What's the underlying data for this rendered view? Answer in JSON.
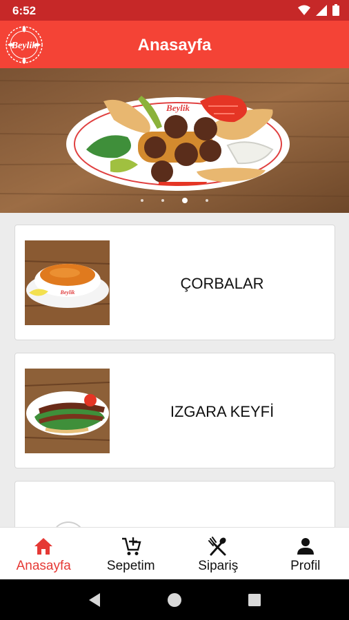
{
  "status_bar": {
    "time": "6:52",
    "icons": [
      "wifi-icon",
      "signal-icon",
      "battery-icon"
    ]
  },
  "app_bar": {
    "title": "Anasayfa",
    "logo_text": "Beylik"
  },
  "banner": {
    "plate_text": "Beylik",
    "slide_count": 4,
    "active_slide": 3
  },
  "categories": [
    {
      "label": "ÇORBALAR",
      "image": "soup-bowl"
    },
    {
      "label": "IZGARA KEYFİ",
      "image": "grilled-kebab-plate"
    },
    {
      "label": "",
      "image": "loading"
    }
  ],
  "bottom_nav": [
    {
      "label": "Anasayfa",
      "icon": "home-icon",
      "active": true
    },
    {
      "label": "Sepetim",
      "icon": "cart-add-icon",
      "active": false
    },
    {
      "label": "Sipariş",
      "icon": "utensils-icon",
      "active": false
    },
    {
      "label": "Profil",
      "icon": "person-icon",
      "active": false
    }
  ],
  "system_nav": [
    "back-icon",
    "home-circle-icon",
    "recents-icon"
  ],
  "colors": {
    "primary": "#f44336",
    "primary_dark": "#c62828",
    "active_nav": "#e53935"
  }
}
